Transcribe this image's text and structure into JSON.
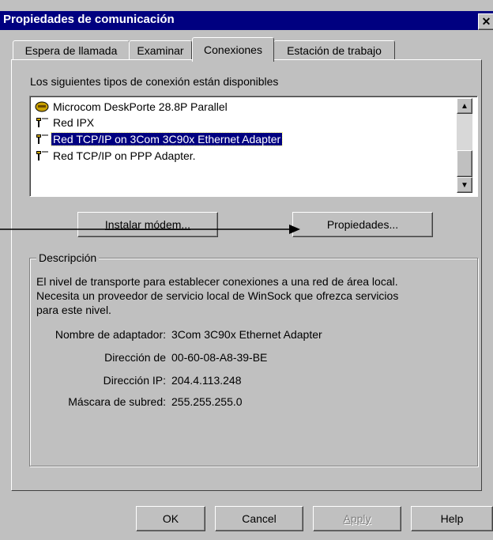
{
  "window": {
    "title": "Propiedades de comunicación",
    "close_label": "✕"
  },
  "tabs": [
    {
      "label": "Espera de llamada",
      "active": false
    },
    {
      "label": "Examinar",
      "active": false
    },
    {
      "label": "Conexiones",
      "active": true
    },
    {
      "label": "Estación de trabajo",
      "active": false
    }
  ],
  "connections": {
    "heading": "Los siguientes tipos de conexión están disponibles",
    "items": [
      {
        "label": "Microcom DeskPorte 28.8P Parallel",
        "icon": "modem-icon",
        "selected": false
      },
      {
        "label": "Red IPX",
        "icon": "network-cable-icon",
        "selected": false
      },
      {
        "label": "Red TCP/IP on 3Com 3C90x Ethernet Adapter",
        "icon": "network-cable-icon",
        "selected": true
      },
      {
        "label": "Red TCP/IP on PPP Adapter.",
        "icon": "network-cable-icon",
        "selected": false
      }
    ],
    "scroll_up": "▲",
    "scroll_down": "▼"
  },
  "buttons": {
    "install_modem": "Instalar módem...",
    "properties": "Propiedades..."
  },
  "description": {
    "group_label": "Descripción",
    "text_lines": [
      "El nivel de transporte para establecer conexiones a una red de área local.",
      "Necesita un proveedor de servicio local de WinSock que ofrezca servicios",
      "para este nivel."
    ],
    "fields": [
      {
        "label": "Nombre de adaptador:",
        "value": "3Com 3C90x Ethernet Adapter"
      },
      {
        "label": "Dirección de",
        "value": "00-60-08-A8-39-BE"
      },
      {
        "label": "Dirección IP:",
        "value": "204.4.113.248"
      },
      {
        "label": "Máscara de subred:",
        "value": "255.255.255.0"
      }
    ]
  },
  "footer": {
    "ok": "OK",
    "cancel": "Cancel",
    "apply": "Apply",
    "help": "Help"
  },
  "colors": {
    "titlebar": "#000080",
    "face": "#c0c0c0",
    "selection": "#000080"
  }
}
